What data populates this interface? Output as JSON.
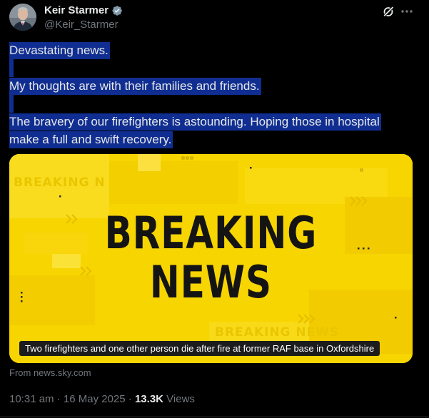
{
  "author": {
    "name": "Keir Starmer",
    "handle": "@Keir_Starmer",
    "verified_icon": "verified-badge-icon"
  },
  "actions": {
    "grok_icon": "grok-icon",
    "more_icon": "more-horizontal-icon"
  },
  "tweet": {
    "lines": [
      "Devastating news.",
      "",
      "My thoughts are with their families and friends.",
      "",
      "The bravery of our firefighters is astounding. Hoping those in hospital",
      "make a full and swift recovery."
    ]
  },
  "media": {
    "headline_line1": "BREAKING",
    "headline_line2": "NEWS",
    "watermark": "BREAKING N",
    "watermark_bottom": "BREAKING NEWS",
    "caption": "Two firefighters and one other person die after fire at former RAF base in Oxfordshire",
    "background_color": "#f6d400"
  },
  "source": "From news.sky.com",
  "meta": {
    "time": "10:31 am",
    "date": "16 May 2025",
    "separator": "·",
    "views_count": "13.3K",
    "views_label": "Views"
  },
  "colors": {
    "background": "#000000",
    "text": "#e7e9ea",
    "secondary": "#71767b",
    "selection_highlight": "#102e91",
    "verified": "#829aab"
  }
}
